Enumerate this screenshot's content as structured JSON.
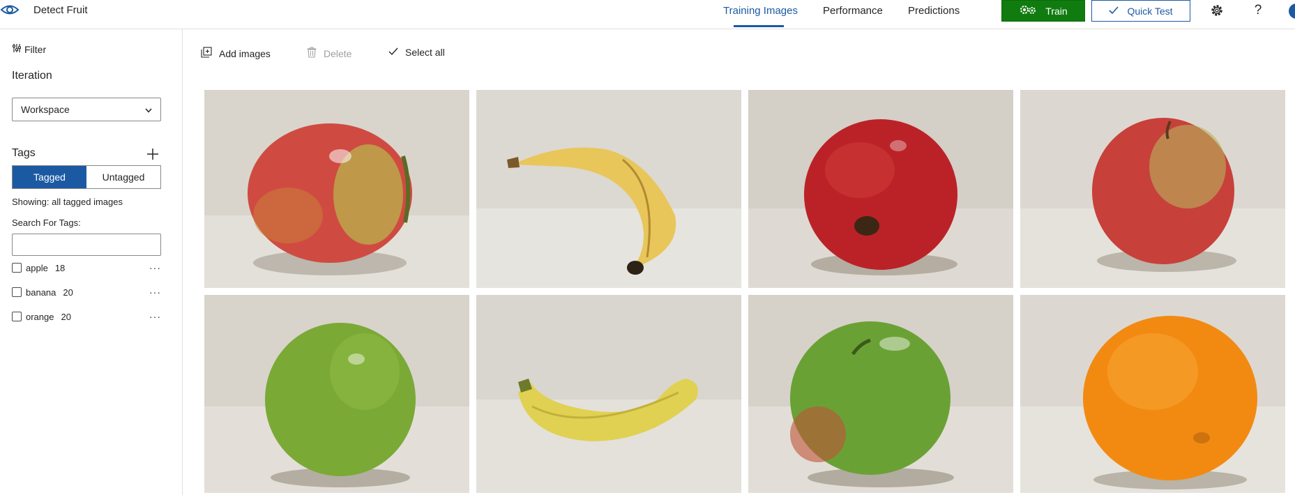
{
  "app": {
    "title": "Detect Fruit"
  },
  "nav": {
    "tabs": [
      {
        "label": "Training Images",
        "active": true
      },
      {
        "label": "Performance",
        "active": false
      },
      {
        "label": "Predictions",
        "active": false
      }
    ],
    "train_label": "Train",
    "quick_test_label": "Quick Test"
  },
  "sidebar": {
    "filter_label": "Filter",
    "iteration_heading": "Iteration",
    "iteration_value": "Workspace",
    "tags_heading": "Tags",
    "tagged_label": "Tagged",
    "untagged_label": "Untagged",
    "showing_text": "Showing: all tagged images",
    "search_label": "Search For Tags:",
    "search_value": "",
    "tags": [
      {
        "name": "apple",
        "count": "18"
      },
      {
        "name": "banana",
        "count": "20"
      },
      {
        "name": "orange",
        "count": "20"
      }
    ],
    "more_glyph": "···"
  },
  "toolbar": {
    "add_images_label": "Add images",
    "delete_label": "Delete",
    "select_all_label": "Select all"
  },
  "images": [
    {
      "fruit": "apple",
      "color": "#c9463d",
      "highlight": "#b8b04d"
    },
    {
      "fruit": "banana",
      "color": "#e6c45a"
    },
    {
      "fruit": "apple",
      "color": "#b81e22",
      "highlight": "#9e1519"
    },
    {
      "fruit": "apple",
      "color": "#c43c37",
      "highlight": "#b7b45d"
    },
    {
      "fruit": "apple",
      "color": "#7fab3a",
      "highlight": "#5f8f2b"
    },
    {
      "fruit": "banana",
      "color": "#dfcf52"
    },
    {
      "fruit": "apple",
      "color": "#6da338",
      "highlight": "#c05438"
    },
    {
      "fruit": "orange",
      "color": "#f28a12"
    }
  ],
  "colors": {
    "accent": "#1b5aa3",
    "train_green": "#107c10",
    "background_cloth": "#dedad2"
  }
}
